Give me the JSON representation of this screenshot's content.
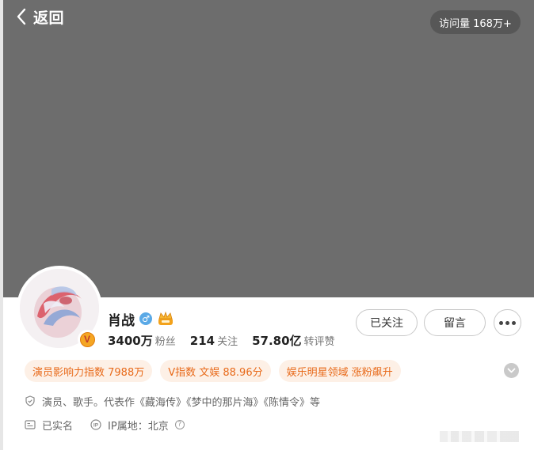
{
  "header": {
    "back_label": "返回",
    "visits_label": "访问量",
    "visits_value": "168万+"
  },
  "profile": {
    "name": "肖战",
    "gender_symbol": "♂",
    "verified_badge": "V",
    "stats": [
      {
        "value": "3400万",
        "unit": "粉丝"
      },
      {
        "value": "214",
        "unit": "关注"
      },
      {
        "value": "57.80亿",
        "unit": "转评赞"
      }
    ]
  },
  "actions": {
    "follow_label": "已关注",
    "message_label": "留言"
  },
  "tags": [
    "演员影响力指数 7988万",
    "V指数 文娱 88.96分",
    "娱乐明星领域 涨粉飙升"
  ],
  "info": {
    "description": "演员、歌手。代表作《藏海传》《梦中的那片海》《陈情令》等",
    "realname": "已实名",
    "ip_location": "IP属地：北京"
  },
  "colors": {
    "cover": "#6d6d6d",
    "tag_bg": "#fdf0e6",
    "tag_text": "#e86a1a",
    "gender": "#5aa9e6",
    "verified": "#f5a623"
  },
  "icons": {
    "back": "chevron-left-icon",
    "gender": "male-icon",
    "crown": "crown-icon",
    "more": "more-dots-icon",
    "expand": "chevron-down-icon",
    "description": "shield-icon",
    "realname": "id-card-icon",
    "ip": "ip-icon",
    "help": "question-icon"
  }
}
